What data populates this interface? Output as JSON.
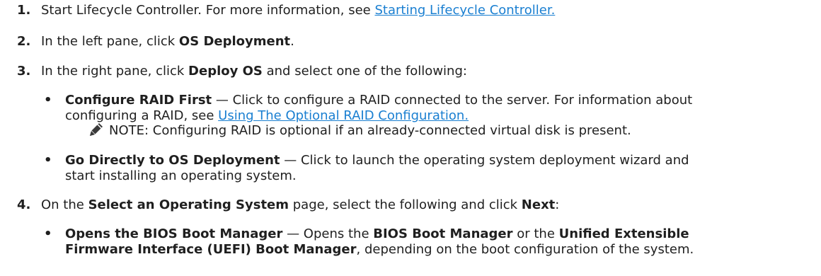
{
  "steps": [
    {
      "num": "1.",
      "text_before": "Start Lifecycle Controller. For more information, see ",
      "link": "Starting Lifecycle Controller."
    },
    {
      "num": "2.",
      "text_before": "In the left pane, click ",
      "bold": "OS Deployment",
      "text_after": "."
    },
    {
      "num": "3.",
      "text_before": "In the right pane, click ",
      "bold": "Deploy OS",
      "text_after": " and select one of the following:"
    },
    {
      "num": "4.",
      "text_before": "On the ",
      "bold1": "Select an Operating System",
      "text_mid": " page, select the following and click ",
      "bold2": "Next",
      "text_after": ":"
    }
  ],
  "step3_bullets": [
    {
      "bullet": "•",
      "bold": "Configure RAID First",
      "line1": " — Click to configure a RAID connected to the server. For information about",
      "line2_before": "configuring a RAID, see ",
      "line2_link": "Using The Optional RAID Configuration."
    },
    {
      "bullet": "•",
      "bold": "Go Directly to OS Deployment",
      "line1": " — Click to launch the operating system deployment wizard and",
      "line2": "start installing an operating system."
    }
  ],
  "note": {
    "label": "NOTE:",
    "text": " Configuring RAID is optional if an already-connected virtual disk is present.",
    "icon": "pencil-note-icon"
  },
  "step4_bullets": [
    {
      "bullet": "•",
      "bold": "Opens the BIOS Boot Manager",
      "line1_mid": " — Opens the ",
      "bold2": "BIOS Boot Manager",
      "line1_mid2": " or the ",
      "bold3": "Unified Extensible",
      "line2_bold": "Firmware Interface (UEFI) Boot Manager",
      "line2_after": ", depending on the boot configuration of the system."
    }
  ],
  "colors": {
    "text": "#1f1f1f",
    "link": "#1a7fd1"
  }
}
